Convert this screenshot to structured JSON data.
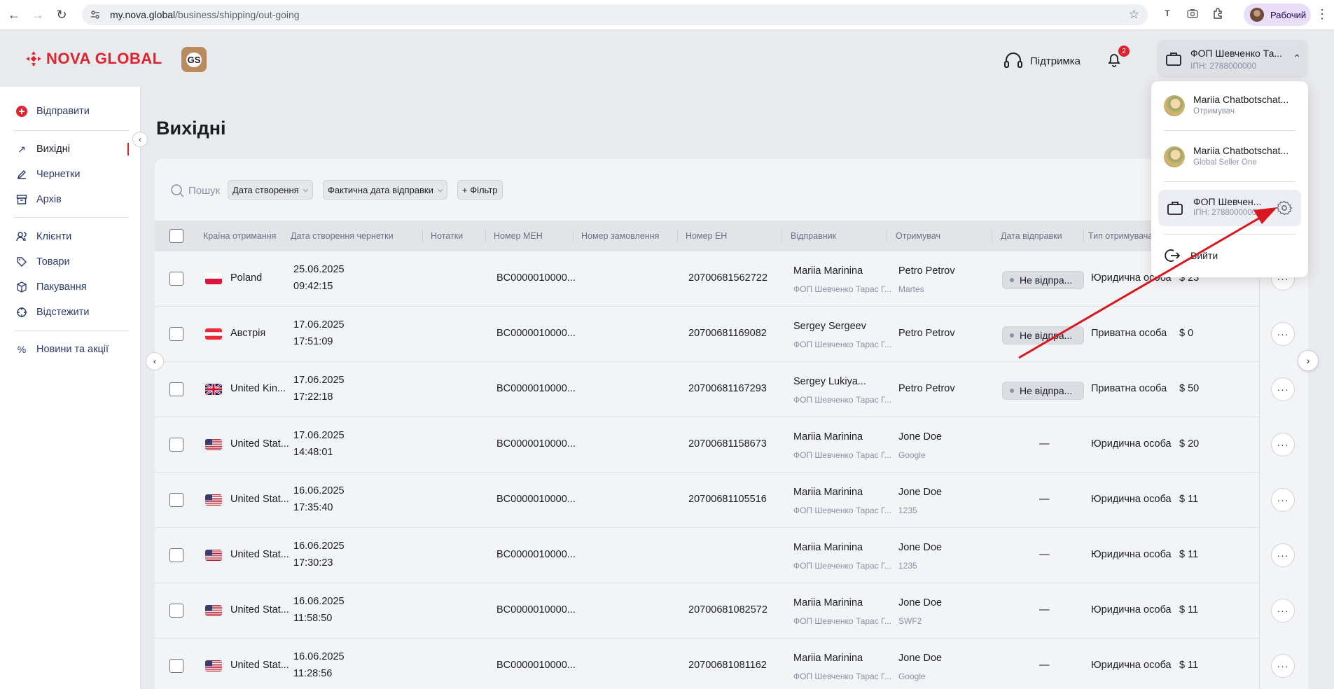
{
  "browser": {
    "url_host": "my.nova.global",
    "url_path": "/business/shipping/out-going",
    "profile_name": "Рабочий"
  },
  "header": {
    "logo_text": "NOVA GLOBAL",
    "gs_badge": "GS",
    "support_label": "Підтримка",
    "notifications_count": "2",
    "account_name": "ФОП Шевченко Та...",
    "account_sub": "ІПН: 2788000000"
  },
  "sidebar": {
    "send_label": "Відправити",
    "items": [
      {
        "label": "Вихідні",
        "icon": "arrow-up-right-icon"
      },
      {
        "label": "Чернетки",
        "icon": "edit-icon"
      },
      {
        "label": "Архів",
        "icon": "archive-icon"
      },
      {
        "label": "Клієнти",
        "icon": "users-icon"
      },
      {
        "label": "Товари",
        "icon": "tag-icon"
      },
      {
        "label": "Пакування",
        "icon": "box-icon"
      },
      {
        "label": "Відстежити",
        "icon": "track-icon"
      },
      {
        "label": "Новини та акції",
        "icon": "percent-icon"
      }
    ]
  },
  "page": {
    "title": "Вихідні",
    "search_placeholder": "Пошук",
    "filter_created": "Дата створення",
    "filter_actual": "Фактична дата відправки",
    "filter_add": "+ Фільтр"
  },
  "table": {
    "columns": [
      "Країна отримання",
      "Дата створення чернетки",
      "Нотатки",
      "Номер МЕН",
      "Номер замовлення",
      "Номер ЕН",
      "Відправник",
      "Отримувач",
      "Дата відправки",
      "Тип отримувача"
    ],
    "rows": [
      {
        "flag": "pl",
        "country": "Poland",
        "date": "25.06.2025",
        "time": "09:42:15",
        "men": "BC0000010000...",
        "en": "20700681562722",
        "sender": "Mariia Marinina",
        "sender_sub": "ФОП Шевченко Тарас Г...",
        "recipient": "Petro Petrov",
        "recipient_sub": "Martes",
        "ship_status": "Не відпра...",
        "type": "Юридична особа",
        "amount": "$ 23"
      },
      {
        "flag": "at",
        "country": "Австрія",
        "date": "17.06.2025",
        "time": "17:51:09",
        "men": "BC0000010000...",
        "en": "20700681169082",
        "sender": "Sergey Sergeev",
        "sender_sub": "ФОП Шевченко Тарас Г...",
        "recipient": "Petro Petrov",
        "recipient_sub": "",
        "ship_status": "Не відпра...",
        "type": "Приватна особа",
        "amount": "$ 0"
      },
      {
        "flag": "gb",
        "country": "United Kin...",
        "date": "17.06.2025",
        "time": "17:22:18",
        "men": "BC0000010000...",
        "en": "20700681167293",
        "sender": "Sergey Lukiya...",
        "sender_sub": "ФОП Шевченко Тарас Г...",
        "recipient": "Petro Petrov",
        "recipient_sub": "",
        "ship_status": "Не відпра...",
        "type": "Приватна особа",
        "amount": "$ 50"
      },
      {
        "flag": "us",
        "country": "United Stat...",
        "date": "17.06.2025",
        "time": "14:48:01",
        "men": "BC0000010000...",
        "en": "20700681158673",
        "sender": "Mariia Marinina",
        "sender_sub": "ФОП Шевченко Тарас Г...",
        "recipient": "Jone Doe",
        "recipient_sub": "Google",
        "ship_status": "—",
        "type": "Юридична особа",
        "amount": "$ 20"
      },
      {
        "flag": "us",
        "country": "United Stat...",
        "date": "16.06.2025",
        "time": "17:35:40",
        "men": "BC0000010000...",
        "en": "20700681105516",
        "sender": "Mariia Marinina",
        "sender_sub": "ФОП Шевченко Тарас Г...",
        "recipient": "Jone Doe",
        "recipient_sub": "1235",
        "ship_status": "—",
        "type": "Юридична особа",
        "amount": "$ 11"
      },
      {
        "flag": "us",
        "country": "United Stat...",
        "date": "16.06.2025",
        "time": "17:30:23",
        "men": "BC0000010000...",
        "en": "",
        "sender": "Mariia Marinina",
        "sender_sub": "ФОП Шевченко Тарас Г...",
        "recipient": "Jone Doe",
        "recipient_sub": "1235",
        "ship_status": "—",
        "type": "Юридична особа",
        "amount": "$ 11"
      },
      {
        "flag": "us",
        "country": "United Stat...",
        "date": "16.06.2025",
        "time": "11:58:50",
        "men": "BC0000010000...",
        "en": "20700681082572",
        "sender": "Mariia Marinina",
        "sender_sub": "ФОП Шевченко Тарас Г...",
        "recipient": "Jone Doe",
        "recipient_sub": "SWF2",
        "ship_status": "—",
        "type": "Юридична особа",
        "amount": "$ 11"
      },
      {
        "flag": "us",
        "country": "United Stat...",
        "date": "16.06.2025",
        "time": "11:28:56",
        "men": "BC0000010000...",
        "en": "20700681081162",
        "sender": "Mariia Marinina",
        "sender_sub": "ФОП Шевченко Тарас Г...",
        "recipient": "Jone Doe",
        "recipient_sub": "Google",
        "ship_status": "—",
        "type": "Юридична особа",
        "amount": "$ 11"
      }
    ]
  },
  "dropdown": {
    "items": [
      {
        "name": "Mariia Chatbotschat...",
        "sub": "Отримувач"
      },
      {
        "name": "Mariia Chatbotschat...",
        "sub": "Global Seller One"
      },
      {
        "name": "ФОП Шевчен...",
        "sub": "ІПН: 2788000000"
      }
    ],
    "logout_label": "Вийти"
  },
  "colors": {
    "brand_red": "#e0232d",
    "annotation_arrow": "#d7191f"
  }
}
